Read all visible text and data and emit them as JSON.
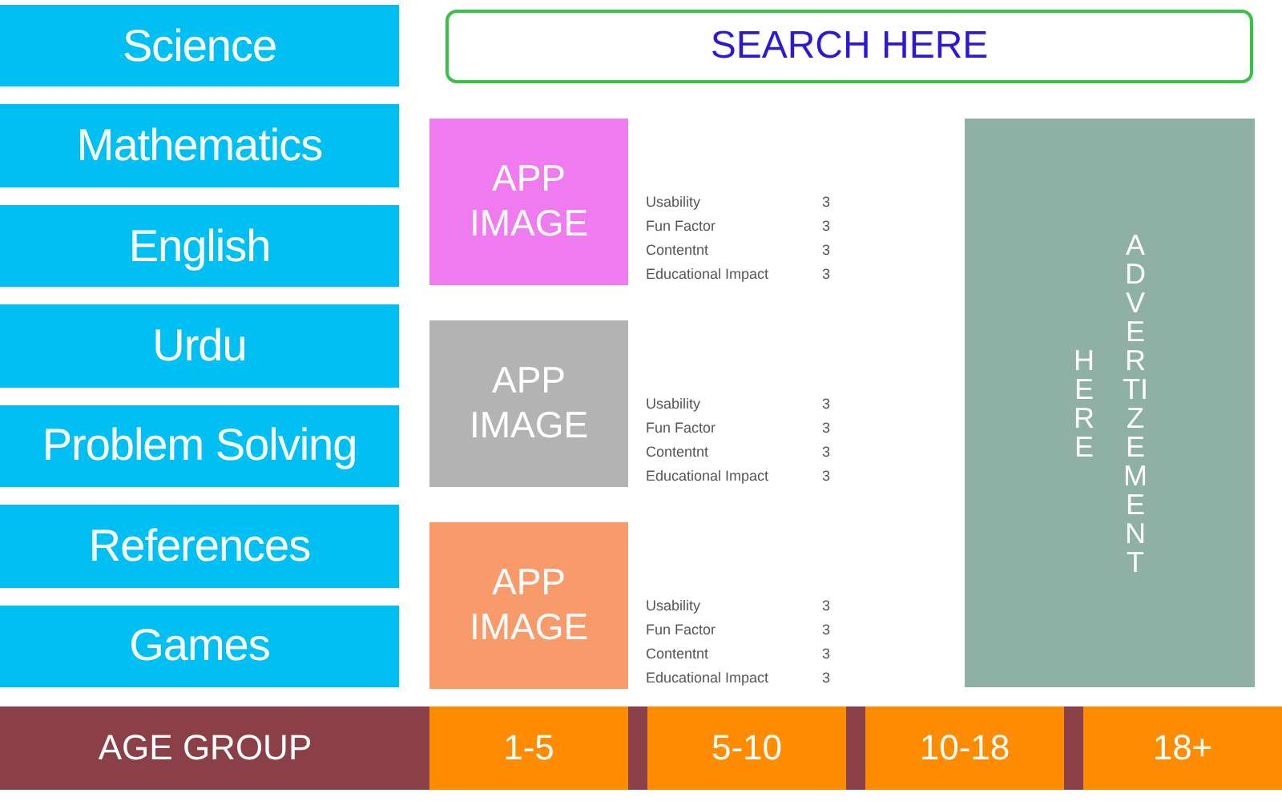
{
  "sidebar": {
    "items": [
      {
        "label": "Science"
      },
      {
        "label": "Mathematics"
      },
      {
        "label": "English"
      },
      {
        "label": "Urdu"
      },
      {
        "label": "Problem Solving"
      },
      {
        "label": "References"
      },
      {
        "label": "Games"
      }
    ]
  },
  "search": {
    "placeholder": "SEARCH HERE"
  },
  "apps": [
    {
      "image_label": "APP IMAGE",
      "color": "#f07af0",
      "ratings": [
        {
          "label": "Usability",
          "value": "3"
        },
        {
          "label": "Fun Factor",
          "value": "3"
        },
        {
          "label": "Contentnt",
          "value": "3"
        },
        {
          "label": "Educational Impact",
          "value": "3"
        }
      ]
    },
    {
      "image_label": "APP IMAGE",
      "color": "#b3b3b3",
      "ratings": [
        {
          "label": "Usability",
          "value": "3"
        },
        {
          "label": "Fun Factor",
          "value": "3"
        },
        {
          "label": "Contentnt",
          "value": "3"
        },
        {
          "label": "Educational Impact",
          "value": "3"
        }
      ]
    },
    {
      "image_label": "APP IMAGE",
      "color": "#f89a6a",
      "ratings": [
        {
          "label": "Usability",
          "value": "3"
        },
        {
          "label": "Fun Factor",
          "value": "3"
        },
        {
          "label": "Contentnt",
          "value": "3"
        },
        {
          "label": "Educational Impact",
          "value": "3"
        }
      ]
    }
  ],
  "advertisement": {
    "words": [
      "HERE",
      "ADVERTIZEMENT"
    ]
  },
  "footer": {
    "label": "AGE GROUP",
    "age_groups": [
      "1-5",
      "5-10",
      "10-18",
      "18+"
    ]
  }
}
